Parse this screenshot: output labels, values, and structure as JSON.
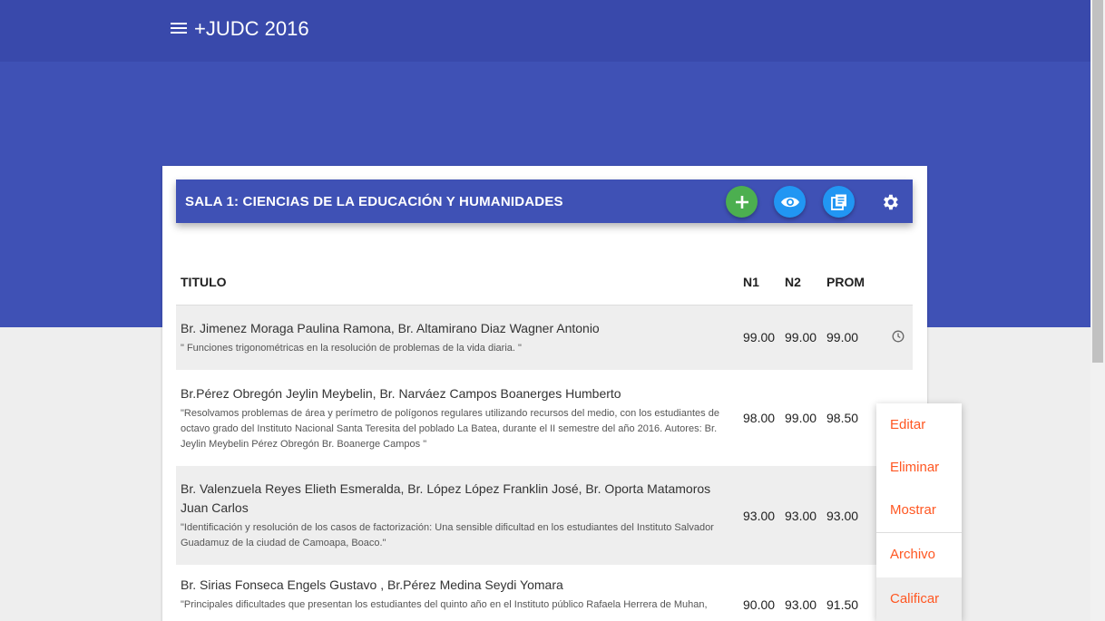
{
  "app": {
    "title": "+JUDC 2016"
  },
  "card": {
    "title": "SALA 1: CIENCIAS DE LA EDUCACIÓN Y HUMANIDADES",
    "add_icon": "plus-icon",
    "view_icon": "eye-icon",
    "library_icon": "library-books-icon",
    "settings_icon": "gear-icon"
  },
  "table": {
    "headers": {
      "titulo": "TITULO",
      "n1": "N1",
      "n2": "N2",
      "prom": "PROM"
    },
    "rows": [
      {
        "authors": "Br. Jimenez Moraga Paulina Ramona, Br. Altamirano Diaz Wagner Antonio",
        "title": "\" Funciones trigonométricas en la resolución de problemas de la vida diaria. \"",
        "n1": "99.00",
        "n2": "99.00",
        "prom": "99.00",
        "icon": "clock-icon"
      },
      {
        "authors": "Br.Pérez Obregón Jeylin Meybelin, Br. Narváez Campos Boanerges Humberto",
        "title": "\"Resolvamos problemas de área y perímetro de polígonos regulares utilizando recursos del medio, con los estudiantes de octavo grado del Instituto Nacional Santa Teresita del poblado La Batea, durante el II semestre del año 2016. Autores: Br. Jeylin Meybelin Pérez Obregón Br. Boanerge Campos \"",
        "n1": "98.00",
        "n2": "99.00",
        "prom": "98.50"
      },
      {
        "authors": "Br. Valenzuela Reyes Elieth Esmeralda, Br. López López Franklin José, Br. Oporta Matamoros Juan Carlos",
        "title": "\"Identificación y resolución de los casos de factorización: Una sensible dificultad en los estudiantes del Instituto Salvador Guadamuz de la ciudad de Camoapa, Boaco.\"",
        "n1": "93.00",
        "n2": "93.00",
        "prom": "93.00"
      },
      {
        "authors": "Br. Sirias Fonseca Engels Gustavo , Br.Pérez Medina Seydi Yomara",
        "title": "\"Principales dificultades que presentan los estudiantes del quinto año en el Instituto público Rafaela Herrera de Muhan,",
        "n1": "90.00",
        "n2": "93.00",
        "prom": "91.50"
      }
    ]
  },
  "menu": {
    "items": [
      "Editar",
      "Eliminar",
      "Mostrar",
      "Archivo",
      "Calificar"
    ],
    "accent": "#ff5722"
  },
  "colors": {
    "primary": "#3f51b5",
    "appbar": "#3949ab",
    "add": "#4caf50",
    "action": "#2196f3"
  }
}
